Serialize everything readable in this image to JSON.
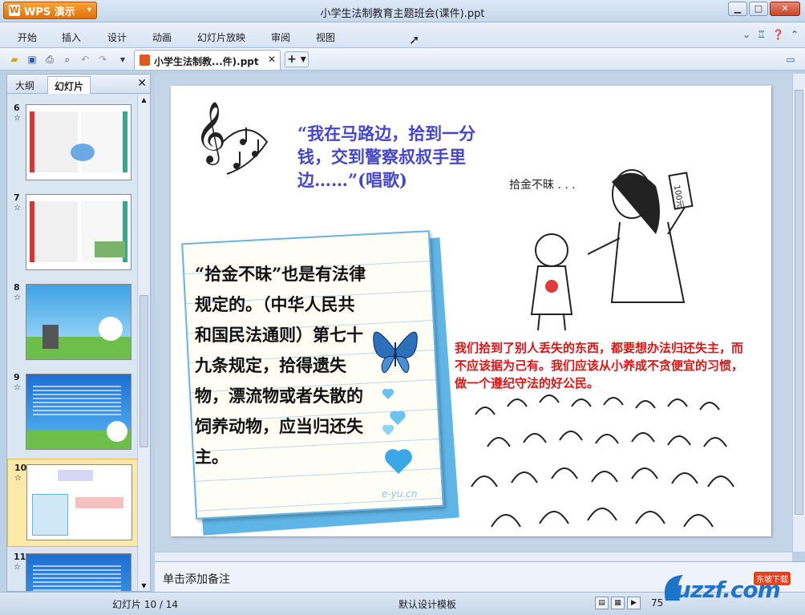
{
  "app": {
    "brand": "WPS 演示",
    "window_title": "小学生法制教育主题班会(课件).ppt"
  },
  "menu": [
    "开始",
    "插入",
    "设计",
    "动画",
    "幻灯片放映",
    "审阅",
    "视图"
  ],
  "doc_tab": {
    "label": "小学生法制教...件).ppt"
  },
  "panel": {
    "tabs": [
      "大纲",
      "幻灯片"
    ],
    "slides": [
      {
        "num": "6"
      },
      {
        "num": "7"
      },
      {
        "num": "8"
      },
      {
        "num": "9"
      },
      {
        "num": "10",
        "selected": true
      },
      {
        "num": "11"
      }
    ]
  },
  "slide": {
    "song": "“我在马路边，拾到一分钱，交到警察叔叔手里边……”(唱歌)",
    "card": "“拾金不昧”也是有法律规定的。（中华人民共和国民法通则）第七十九条规定，拾得遗失物，漂流物或者失散的饲养动物，应当归还失主。",
    "watermark_card": "e-yu.cn",
    "cartoon_caption": "拾金不昧 . . .",
    "cartoon_sign": "100元",
    "red_text": "我们拾到了别人丢失的东西，都要想办法归还失主，而不应该据为己有。我们应该从小养成不贪便宜的习惯，做一个遵纪守法的好公民。"
  },
  "notes_placeholder": "单击添加备注",
  "status": {
    "slide_counter": "幻灯片 10 / 14",
    "template": "默认设计模板",
    "zoom": "75"
  },
  "watermark": {
    "main": "uzzf.com",
    "sub": "东坡下载"
  }
}
